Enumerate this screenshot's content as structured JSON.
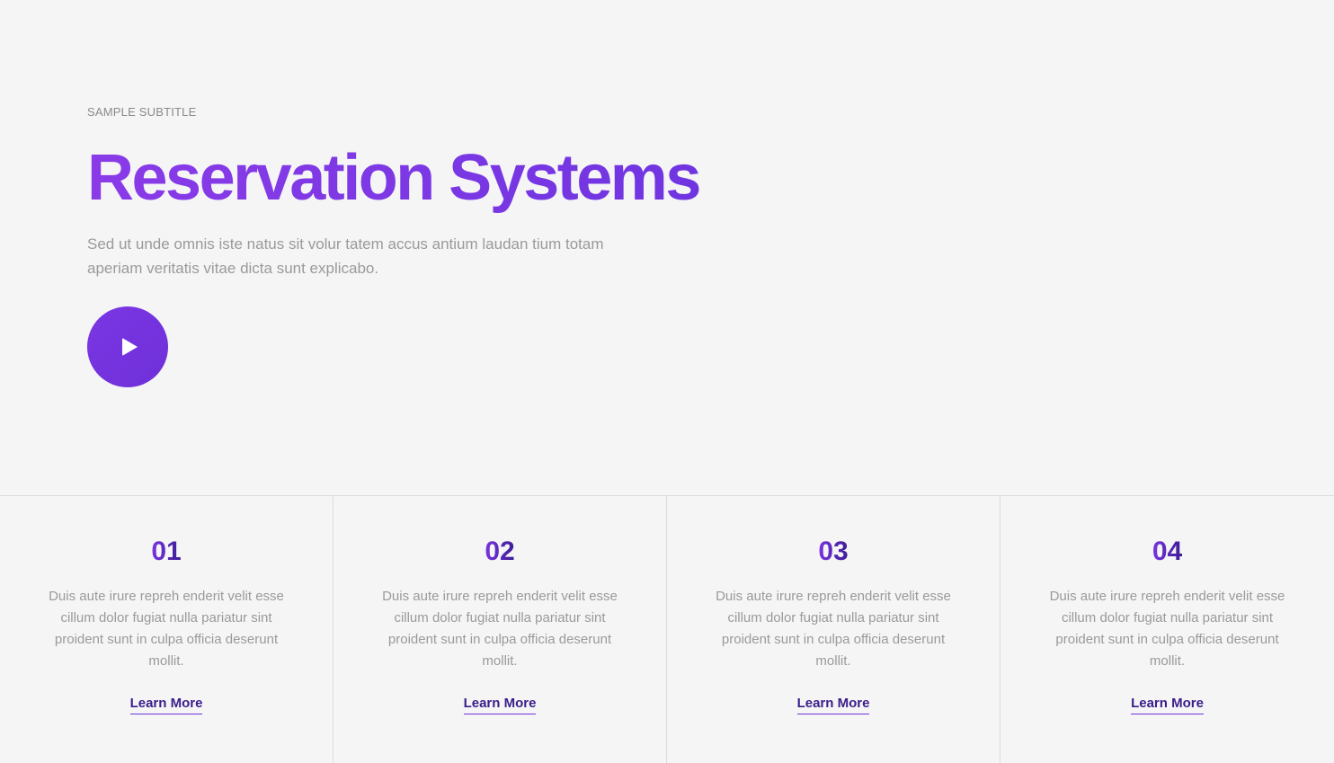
{
  "hero": {
    "subtitle": "SAMPLE SUBTITLE",
    "title": "Reservation Systems",
    "description": "Sed ut unde omnis iste natus sit volur tatem accus antium laudan tium totam aperiam veritatis vitae dicta sunt explicabo.",
    "play_icon": "play-icon"
  },
  "features": [
    {
      "number": "01",
      "text": "Duis aute irure repreh enderit velit esse cillum dolor fugiat nulla pariatur sint proident sunt in culpa officia deserunt mollit.",
      "link": "Learn More"
    },
    {
      "number": "02",
      "text": "Duis aute irure repreh enderit velit esse cillum dolor fugiat nulla pariatur sint proident sunt in culpa officia deserunt mollit.",
      "link": "Learn More"
    },
    {
      "number": "03",
      "text": "Duis aute irure repreh enderit velit esse cillum dolor fugiat nulla pariatur sint proident sunt in culpa officia deserunt mollit.",
      "link": "Learn More"
    },
    {
      "number": "04",
      "text": "Duis aute irure repreh enderit velit esse cillum dolor fugiat nulla pariatur sint proident sunt in culpa officia deserunt mollit.",
      "link": "Learn More"
    }
  ],
  "colors": {
    "accent": "#7a36e4",
    "background": "#f5f5f5",
    "muted_text": "#9a9a9a",
    "link_text": "#3b1d8a"
  }
}
